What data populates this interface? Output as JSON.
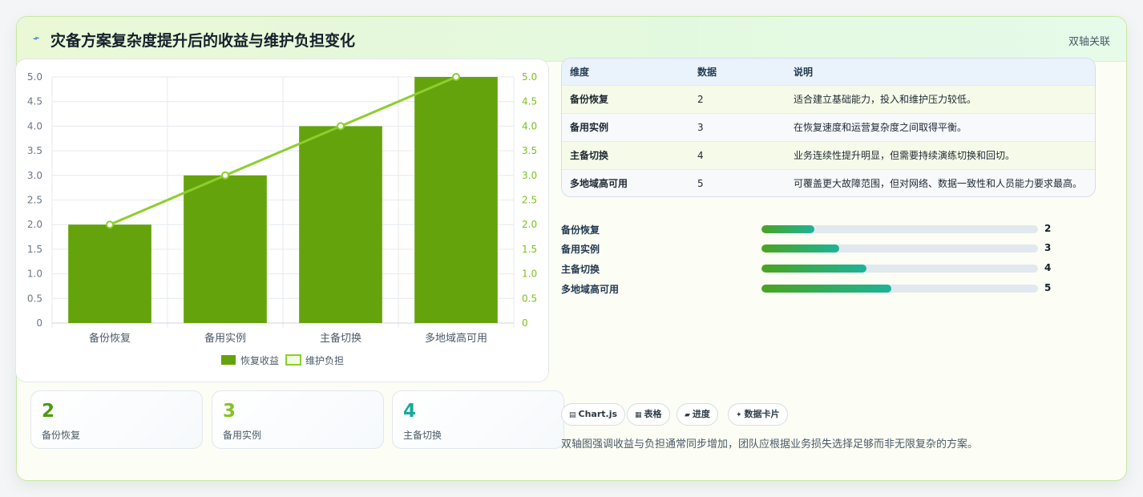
{
  "header": {
    "title": "灾备方案复杂度提升后的收益与维护负担变化",
    "tag": "双轴关联",
    "icon": "lightning-icon"
  },
  "chart_data": {
    "type": "bar",
    "categories": [
      "备份恢复",
      "备用实例",
      "主备切换",
      "多地域高可用"
    ],
    "series": [
      {
        "name": "恢复收益",
        "type": "bar",
        "axis": "left",
        "values": [
          2,
          3,
          4,
          5
        ],
        "color": "#65a30d"
      },
      {
        "name": "维护负担",
        "type": "line",
        "axis": "right",
        "values": [
          2,
          3,
          4,
          5
        ],
        "color": "#8ccf2c"
      }
    ],
    "ylim": [
      0,
      5
    ],
    "y2lim": [
      0,
      5
    ],
    "yticks": [
      "0",
      "0.5",
      "1.0",
      "1.5",
      "2.0",
      "2.5",
      "3.0",
      "3.5",
      "4.0",
      "4.5",
      "5.0"
    ],
    "y2ticks": [
      "0",
      "0.5",
      "1.0",
      "1.5",
      "2.0",
      "2.5",
      "3.0",
      "3.5",
      "4.0",
      "4.5",
      "5.0"
    ],
    "grid": true,
    "legend": "bottom"
  },
  "stats": [
    {
      "value": "2",
      "label": "备份恢复",
      "color": "#4d9a12"
    },
    {
      "value": "3",
      "label": "备用实例",
      "color": "#84c225"
    },
    {
      "value": "4",
      "label": "主备切换",
      "color": "#19a99a"
    }
  ],
  "table": {
    "headers": [
      "维度",
      "数据",
      "说明"
    ],
    "rows": [
      [
        "备份恢复",
        "2",
        "适合建立基础能力，投入和维护压力较低。"
      ],
      [
        "备用实例",
        "3",
        "在恢复速度和运营复杂度之间取得平衡。"
      ],
      [
        "主备切换",
        "4",
        "业务连续性提升明显，但需要持续演练切换和回切。"
      ],
      [
        "多地域高可用",
        "5",
        "可覆盖更大故障范围，但对网络、数据一致性和人员能力要求最高。"
      ]
    ]
  },
  "progress": {
    "items": [
      {
        "label": "备份恢复",
        "value": "2",
        "fraction": 0.19
      },
      {
        "label": "备用实例",
        "value": "3",
        "fraction": 0.28
      },
      {
        "label": "主备切换",
        "value": "4",
        "fraction": 0.38
      },
      {
        "label": "多地域高可用",
        "value": "5",
        "fraction": 0.47
      }
    ]
  },
  "chips": [
    {
      "icon": "chart-icon",
      "glyph": "▤",
      "label": "Chart.js"
    },
    {
      "icon": "table-icon",
      "glyph": "▦",
      "label": "表格"
    },
    {
      "icon": "progress-icon",
      "glyph": "▰",
      "label": "进度"
    },
    {
      "icon": "sparkle-icon",
      "glyph": "✦",
      "label": "数据卡片"
    }
  ],
  "footnote": "双轴图强调收益与负担通常同步增加，团队应根据业务损失选择足够而非无限复杂的方案。"
}
